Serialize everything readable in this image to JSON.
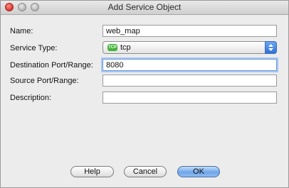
{
  "window": {
    "title": "Add Service Object"
  },
  "form": {
    "name_label": "Name:",
    "name_value": "web_map",
    "service_type_label": "Service Type:",
    "service_type_badge": "TCP",
    "service_type_value": "tcp",
    "dest_port_label": "Destination Port/Range:",
    "dest_port_value": "8080",
    "source_port_label": "Source Port/Range:",
    "source_port_value": "",
    "description_label": "Description:",
    "description_value": ""
  },
  "buttons": {
    "help": "Help",
    "cancel": "Cancel",
    "ok": "OK"
  },
  "icons": {
    "close": "close-icon",
    "minimize": "minimize-icon",
    "zoom": "zoom-icon",
    "service_type": "tcp-icon",
    "select_arrows": "select-arrows-icon"
  }
}
